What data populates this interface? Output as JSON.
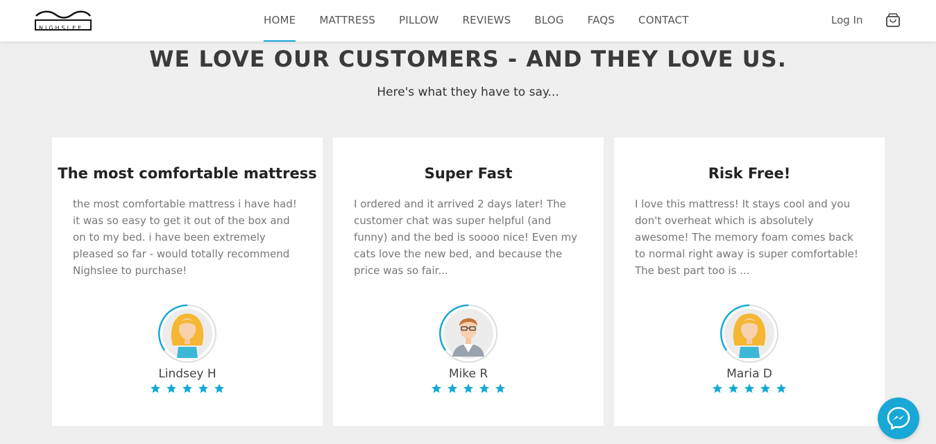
{
  "brand": {
    "logo_text": "NIGHSLEE"
  },
  "nav": {
    "items": [
      {
        "label": "HOME",
        "active": true
      },
      {
        "label": "MATTRESS",
        "active": false
      },
      {
        "label": "PILLOW",
        "active": false
      },
      {
        "label": "REVIEWS",
        "active": false
      },
      {
        "label": "BLOG",
        "active": false
      },
      {
        "label": "FAQS",
        "active": false
      },
      {
        "label": "CONTACT",
        "active": false
      }
    ],
    "login_label": "Log In",
    "cart_icon": "shopping-bag-icon"
  },
  "section": {
    "title": "WE LOVE OUR CUSTOMERS - AND THEY LOVE US.",
    "subtitle": "Here's what they have to say..."
  },
  "reviews": [
    {
      "title": "The most comfortable mattress",
      "text": "the most comfortable mattress i have had! it was so easy to get it out of the box and on to my bed. i have been extremely pleased so far - would totally recommend Nighslee to purchase!",
      "name": "Lindsey H",
      "avatar": "female-avatar-icon",
      "rating": 5
    },
    {
      "title": "Super Fast",
      "text": "I ordered and it arrived 2 days later! The customer chat was super helpful (and funny) and the bed is soooo nice! Even my cats love the new bed, and because the price was so fair...",
      "name": "Mike R",
      "avatar": "male-avatar-icon",
      "rating": 5
    },
    {
      "title": "Risk Free!",
      "text": "I love this mattress! It stays cool and you don't overheat which is absolutely awesome! The memory foam comes back to normal right away is super comfortable! The best part too is ...",
      "name": "Maria D",
      "avatar": "female-avatar-icon",
      "rating": 5
    }
  ],
  "colors": {
    "accent": "#19a8d6",
    "background": "#efefef",
    "card": "#ffffff"
  },
  "messenger": {
    "icon": "messenger-icon"
  }
}
